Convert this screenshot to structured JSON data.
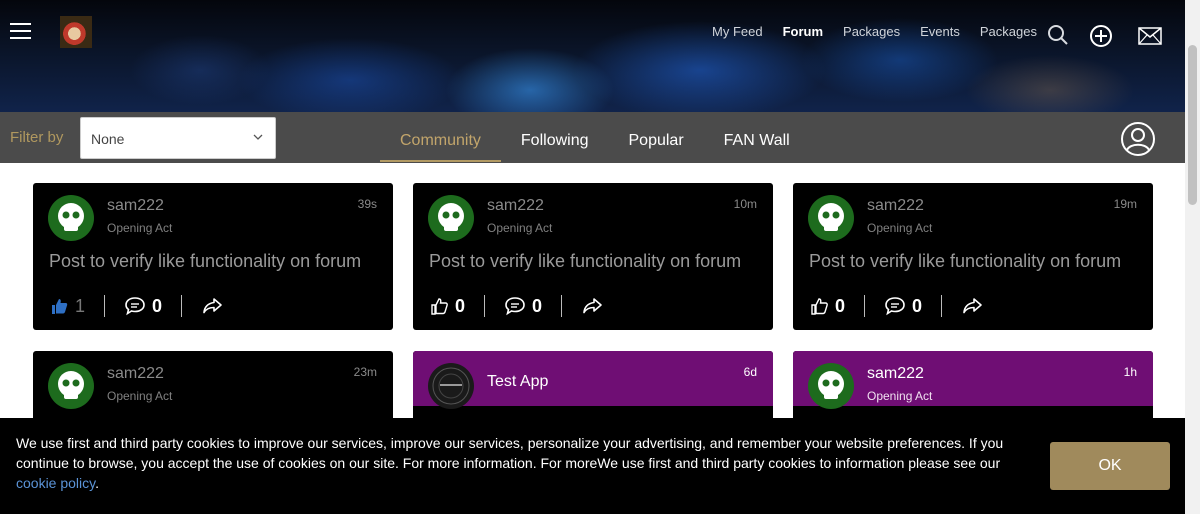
{
  "header": {
    "nav": [
      "My Feed",
      "Forum",
      "Packages",
      "Events",
      "Packages"
    ],
    "active_nav": "Forum",
    "icons": [
      "menu-icon",
      "search-icon",
      "add-icon",
      "mail-icon"
    ]
  },
  "filter": {
    "label": "Filter by",
    "selected": "None"
  },
  "tabs": [
    "Community",
    "Following",
    "Popular",
    "FAN Wall"
  ],
  "active_tab": "Community",
  "colors": {
    "accent": "#b29a63",
    "purple": "#6f0e74",
    "avatar_green": "#1d6b1d",
    "like_blue": "#2e6fc4"
  },
  "posts": [
    {
      "name": "sam222",
      "role": "Opening Act",
      "time": "39s",
      "body": "Post to verify like functionality on forum",
      "likes": "1",
      "comments": "0"
    },
    {
      "name": "sam222",
      "role": "Opening Act",
      "time": "10m",
      "body": "Post to verify like functionality on forum",
      "likes": "0",
      "comments": "0"
    },
    {
      "name": "sam222",
      "role": "Opening Act",
      "time": "19m",
      "body": "Post to verify like functionality on forum",
      "likes": "0",
      "comments": "0"
    },
    {
      "name": "sam222",
      "role": "Opening Act",
      "time": "23m"
    },
    {
      "name": "Test App",
      "time": "6d"
    },
    {
      "name": "sam222",
      "role": "Opening Act",
      "time": "1h"
    }
  ],
  "cookie": {
    "text": "We use first and third party cookies to improve our services, improve our services, personalize your advertising, and remember your website preferences. If you continue to browse, you accept the use of cookies on our site. For more information. For moreWe use first and third party cookies to information please see our",
    "link": "cookie policy",
    "suffix": ".",
    "ok": "OK"
  }
}
